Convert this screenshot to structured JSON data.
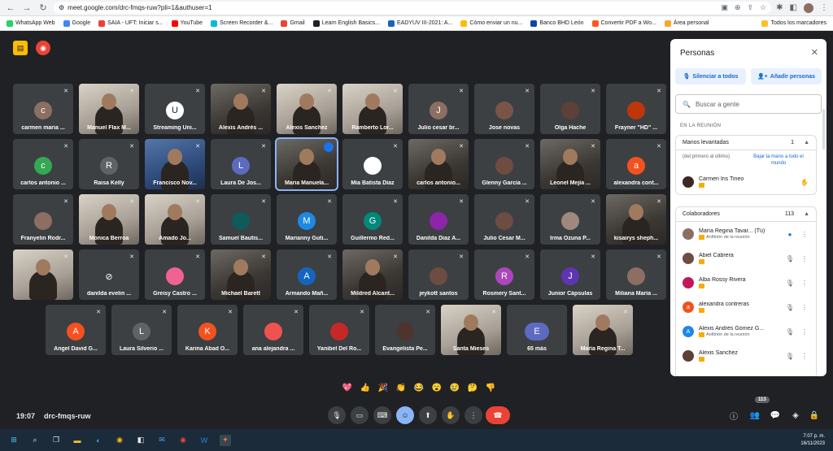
{
  "browser": {
    "url": "meet.google.com/drc-fmqs-ruw?pli=1&authuser=1",
    "bookmarks": [
      "WhatsApp Web",
      "Google",
      "SAIA - UFT: Iniciar s...",
      "YouTube",
      "Screen Recorder &...",
      "Gmail",
      "Learn English Basics...",
      "EADYUV III-2021: A...",
      "Cómo enviar un nu...",
      "Banco BHD León",
      "Convertir PDF a Wo...",
      "Área personal"
    ],
    "bookmarks_folder": "Todos los marcadores",
    "bookmark_colors": [
      "#25d366",
      "#4285f4",
      "#ea4335",
      "#ff0000",
      "#00bcd4",
      "#ea4335",
      "#202124",
      "#1565c0",
      "#fbbc05",
      "#0d47a1",
      "#ff5722",
      "#f9a825"
    ]
  },
  "meeting": {
    "time": "19:07",
    "code": "drc-fmqs-ruw",
    "more_label": "65 más",
    "participant_count_badge": "113"
  },
  "tiles": [
    {
      "name": "carmen maria ...",
      "initial": "c",
      "color": "#8d6e63",
      "type": "avatar"
    },
    {
      "name": "Manuel Flax M...",
      "type": "video",
      "tone": "light"
    },
    {
      "name": "Streaming Uni...",
      "initial": "U",
      "color": "#ffffff",
      "type": "avatar"
    },
    {
      "name": "Alexis Andrés ...",
      "type": "video",
      "tone": "dark"
    },
    {
      "name": "Alexis Sanchez",
      "type": "video",
      "tone": "light"
    },
    {
      "name": "Ramberto Lor...",
      "type": "video",
      "tone": "light"
    },
    {
      "name": "Julio cesar br...",
      "initial": "J",
      "color": "#8d6e63",
      "type": "avatar"
    },
    {
      "name": "Jose novas",
      "initial": "",
      "color": "#795548",
      "type": "avatar"
    },
    {
      "name": "Olga Hache",
      "initial": "",
      "color": "#5d4037",
      "type": "avatar"
    },
    {
      "name": "Frayner \"HD\" ...",
      "initial": "",
      "color": "#bf360c",
      "type": "avatar"
    },
    {
      "name": "carlos antonio ...",
      "initial": "c",
      "color": "#34a853",
      "type": "avatar"
    },
    {
      "name": "Raisa Kelly",
      "initial": "R",
      "color": "#5f6368",
      "type": "avatar"
    },
    {
      "name": "Francisco Nov...",
      "type": "video",
      "tone": "blue"
    },
    {
      "name": "Laura De Jos...",
      "initial": "L",
      "color": "#5c6bc0",
      "type": "avatar"
    },
    {
      "name": "Maria Manuela...",
      "type": "video",
      "tone": "dark",
      "active": true
    },
    {
      "name": "Mia Batista Díaz",
      "initial": "",
      "color": "#ffffff",
      "type": "avatar"
    },
    {
      "name": "carlos antonio...",
      "type": "video",
      "tone": "dark"
    },
    {
      "name": "Glenny García ...",
      "initial": "",
      "color": "#6d4c41",
      "type": "avatar"
    },
    {
      "name": "Leonel Mejía ...",
      "type": "video",
      "tone": "dark"
    },
    {
      "name": "alexandra cont...",
      "initial": "a",
      "color": "#f4511e",
      "type": "avatar"
    },
    {
      "name": "Franyelin Rodr...",
      "initial": "",
      "color": "#8d6e63",
      "type": "avatar"
    },
    {
      "name": "Monica Berroa",
      "type": "video",
      "tone": "light"
    },
    {
      "name": "Amado Jo...",
      "type": "video",
      "tone": "light"
    },
    {
      "name": "Samuel Bautis...",
      "initial": "",
      "color": "#0d5b5b",
      "type": "avatar"
    },
    {
      "name": "Marianny Guti...",
      "initial": "M",
      "color": "#1e88e5",
      "type": "avatar"
    },
    {
      "name": "Guillermo Red...",
      "initial": "G",
      "color": "#00897b",
      "type": "avatar"
    },
    {
      "name": "Danilda Diaz A...",
      "initial": "",
      "color": "#8e24aa",
      "type": "avatar"
    },
    {
      "name": "Julio Cesar M...",
      "initial": "",
      "color": "#6d4c41",
      "type": "avatar"
    },
    {
      "name": "Irma Ozuna P...",
      "initial": "",
      "color": "#a1887f",
      "type": "avatar"
    },
    {
      "name": "kisairys sheph...",
      "type": "video",
      "tone": "dark"
    },
    {
      "name": "",
      "type": "video",
      "tone": "light"
    },
    {
      "name": "danilda evelin ...",
      "initial": "",
      "color": "#9e9e9e",
      "type": "avatar",
      "camoff": true
    },
    {
      "name": "Greisy Castro ...",
      "initial": "",
      "color": "#f06292",
      "type": "avatar"
    },
    {
      "name": "Michael Barett",
      "type": "video",
      "tone": "dark"
    },
    {
      "name": "Armando Mañ...",
      "initial": "A",
      "color": "#1565c0",
      "type": "avatar"
    },
    {
      "name": "Mildred Alcant...",
      "type": "video",
      "tone": "dark"
    },
    {
      "name": "jeykott santos",
      "initial": "",
      "color": "#6d4c41",
      "type": "avatar"
    },
    {
      "name": "Rosmery Sant...",
      "initial": "R",
      "color": "#ab47bc",
      "type": "avatar"
    },
    {
      "name": "Junior Cápsulas",
      "initial": "J",
      "color": "#5e35b1",
      "type": "avatar"
    },
    {
      "name": "Miliana María ...",
      "initial": "",
      "color": "#8d6e63",
      "type": "avatar"
    },
    {
      "name": "Angel David G...",
      "initial": "A",
      "color": "#f4511e",
      "type": "avatar"
    },
    {
      "name": "Laura Silverio ...",
      "initial": "L",
      "color": "#5f6368",
      "type": "avatar"
    },
    {
      "name": "Karina Abad O...",
      "initial": "K",
      "color": "#f4511e",
      "type": "avatar"
    },
    {
      "name": "ana alejandra ...",
      "initial": "",
      "color": "#ef5350",
      "type": "avatar"
    },
    {
      "name": "Yanibel Del Ro...",
      "initial": "",
      "color": "#c62828",
      "type": "avatar"
    },
    {
      "name": "Evangelista Pe...",
      "initial": "",
      "color": "#4e342e",
      "type": "avatar"
    },
    {
      "name": "Santa Mieses",
      "type": "video",
      "tone": "light"
    },
    {
      "name": "65 más",
      "initial": "E",
      "color": "#5c6bc0",
      "type": "more"
    },
    {
      "name": "María Regina T...",
      "type": "video",
      "tone": "light"
    }
  ],
  "reactions": [
    "💖",
    "👍",
    "🎉",
    "👏",
    "😂",
    "😮",
    "😢",
    "🤔",
    "👎"
  ],
  "panel": {
    "title": "Personas",
    "mute_all": "Silenciar a todos",
    "add_people": "Añadir personas",
    "search_placeholder": "Buscar a gente",
    "section_label": "EN LA REUNIÓN",
    "hands": {
      "title": "Manos levantadas",
      "count": "1",
      "order_note": "(del primero al último)",
      "lower_all": "Bajar la mano a todo el mundo",
      "person": "Carmen Iris Tineo"
    },
    "collab": {
      "title": "Colaboradores",
      "count": "113",
      "people": [
        {
          "name": "María Regina Tavar...",
          "suffix": "(Tú)",
          "sub": "Anfitrión de la reunión",
          "color": "#8d6e63",
          "initial": ""
        },
        {
          "name": "Abiel Cabrera",
          "sub": "",
          "color": "#6d4c41",
          "initial": ""
        },
        {
          "name": "Alba Rossy Rivera",
          "sub": "",
          "color": "#c2185b",
          "initial": ""
        },
        {
          "name": "alexandra contreras",
          "sub": "",
          "color": "#f4511e",
          "initial": "a"
        },
        {
          "name": "Alexis Andrés Gómez G...",
          "sub": "Anfitrión de la reunión",
          "color": "#1e88e5",
          "initial": "A"
        },
        {
          "name": "Alexis Sanchez",
          "sub": "",
          "color": "#5d4037",
          "initial": ""
        }
      ]
    }
  },
  "taskbar": {
    "time": "7:07 p. m.",
    "date": "16/11/2023"
  }
}
